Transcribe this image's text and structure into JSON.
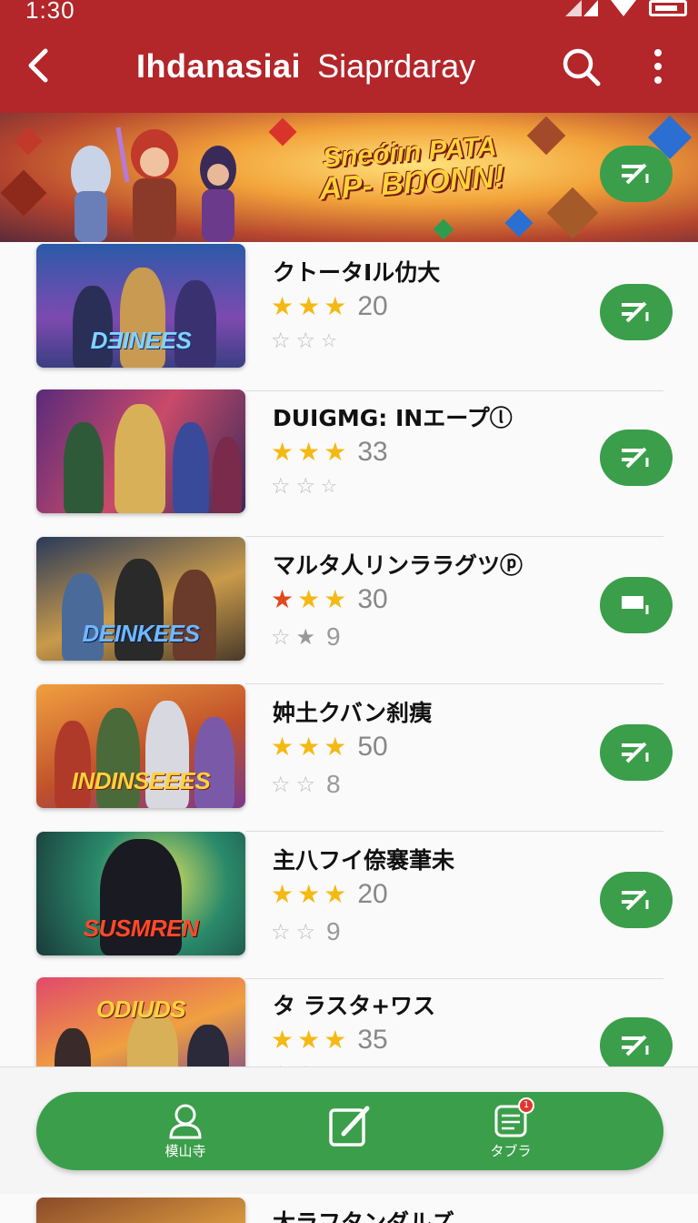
{
  "status": {
    "time": "1:30"
  },
  "appbar": {
    "title_part1": "Ihdanasiai",
    "title_part2": "Siaprdaray",
    "back_icon": "back-arrow-icon",
    "search_icon": "search-icon",
    "more_icon": "more-vertical-icon"
  },
  "banner": {
    "line1": "Sneóiın PATA",
    "line2": "AP- BŊONN!",
    "button_icon": "download-icon"
  },
  "colors": {
    "header": "#b3262a",
    "accent": "#3b9e4a",
    "star": "#f5b914"
  },
  "games": [
    {
      "title": "クトータIル仂大",
      "logo": "DƎINEES",
      "rating": "20",
      "stars2": "",
      "top_stars": [
        "gold",
        "gold",
        "gold"
      ],
      "bottom_stars": [
        "outline",
        "outline",
        "outline"
      ]
    },
    {
      "title": "DUIGMG: INエープⓛ",
      "logo": "",
      "rating": "33",
      "stars2": "",
      "top_stars": [
        "gold",
        "gold",
        "gold"
      ],
      "bottom_stars": [
        "outline",
        "outline",
        "outline"
      ]
    },
    {
      "title": "マルタ人リンララグツⓟ",
      "logo": "DEINKEES",
      "rating": "30",
      "stars2": "9",
      "top_stars": [
        "red",
        "gold",
        "gold"
      ],
      "bottom_stars": [
        "outline",
        "grey"
      ]
    },
    {
      "title": "妕土クバン刹痍",
      "logo": "INDINSEEES",
      "rating": "50",
      "stars2": "8",
      "top_stars": [
        "gold",
        "gold",
        "gold"
      ],
      "bottom_stars": [
        "outline",
        "outline"
      ]
    },
    {
      "title": "主八フイ倷褰茟未",
      "logo": "SUSMREN",
      "rating": "20",
      "stars2": "9",
      "top_stars": [
        "gold",
        "gold",
        "gold"
      ],
      "bottom_stars": [
        "outline",
        "outline"
      ]
    },
    {
      "title": "タ ラスタ+ワス",
      "logo": "ODIUDS",
      "rating": "35",
      "stars2": "",
      "top_stars": [
        "gold",
        "gold",
        "gold"
      ],
      "bottom_stars": [
        "outline",
        "outline"
      ]
    }
  ],
  "peek_title": "大ラフタンダルズ",
  "bottom_nav": [
    {
      "label": "模山寺",
      "icon": "person-icon"
    },
    {
      "label": "",
      "icon": "edit-icon"
    },
    {
      "label": "タブラ",
      "icon": "notes-icon",
      "badge": "1"
    }
  ]
}
